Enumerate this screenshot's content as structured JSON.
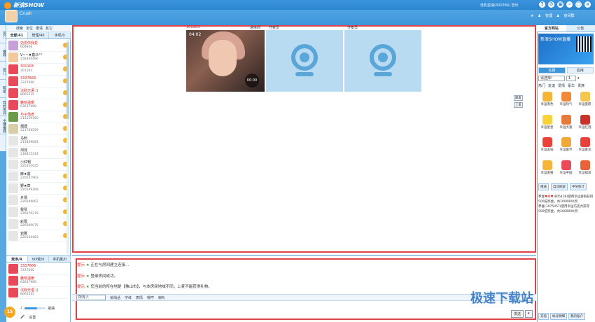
{
  "app": {
    "title": "新浪SHOW",
    "account": "佳影盈瑞(600384) 登出"
  },
  "room": {
    "username": "Crush"
  },
  "right_links": [
    "管理",
    "房间群"
  ],
  "vertical_tabs": [
    "热门",
    "推荐",
    "热门",
    "明星",
    "我的房间",
    "主播推荐"
  ],
  "left_toolbar": [
    "搜索",
    "定位",
    "邀请",
    "其它"
  ],
  "left_tabs": [
    "全部/41",
    "管理/40",
    "手机/0"
  ],
  "users": [
    {
      "name": "迈爱依我爱",
      "id": "609926",
      "red": true,
      "color": "#c7a0d8"
    },
    {
      "name": "V~~♦鑫众°°",
      "id": "258306486",
      "red": false,
      "color": "#f3c89a"
    },
    {
      "name": "301103",
      "id": "301103",
      "red": true,
      "color": "#e84a5a"
    },
    {
      "name": "3337666",
      "id": "3337666",
      "red": true,
      "color": "#e84a5a"
    },
    {
      "name": "沉默无语 ()",
      "id": "8065535",
      "red": true,
      "color": "#e84a5a"
    },
    {
      "name": "魅晓温暖",
      "id": "63637968",
      "red": true,
      "color": "#e84a5a"
    },
    {
      "name": "与子偕老",
      "id": "215559160",
      "red": true,
      "color": "#6b9a48"
    },
    {
      "name": "烟酒",
      "id": "211706559",
      "red": false,
      "color": "#d8cfa8"
    },
    {
      "name": "马刺",
      "id": "215839083",
      "red": false,
      "color": "#e6e6e6"
    },
    {
      "name": "淘淀",
      "id": "218825314",
      "red": false,
      "color": "#e6e6e6"
    },
    {
      "name": "小红帽",
      "id": "220354025",
      "red": false,
      "color": "#e6e6e6"
    },
    {
      "name": "麻★莲",
      "id": "220547963",
      "red": false,
      "color": "#e6e6e6"
    },
    {
      "name": "野★草",
      "id": "220549268",
      "red": false,
      "color": "#e6e6e6"
    },
    {
      "name": "乡情",
      "id": "226049662",
      "red": false,
      "color": "#e6e6e6"
    },
    {
      "name": "我琴",
      "id": "226070279",
      "red": false,
      "color": "#e6e6e6"
    },
    {
      "name": "彩霞",
      "id": "226090075",
      "red": false,
      "color": "#e6e6e6"
    },
    {
      "name": "岩翼",
      "id": "226104483",
      "red": false,
      "color": "#e6e6e6"
    }
  ],
  "left_tabs2": [
    "麦序/4",
    "VIP麦/0",
    "手机麦/0"
  ],
  "users2": [
    {
      "name": "3337666",
      "id": "3337666"
    },
    {
      "name": "魅晓温暖",
      "id": "63637968"
    },
    {
      "name": "沉默无语 ()",
      "id": "8065535"
    }
  ],
  "volume": {
    "label": "歌曲",
    "level": 0.6
  },
  "left_bottom": [
    "设置"
  ],
  "badge": "15",
  "video": {
    "slots": [
      {
        "label": "301103",
        "mode": "进房间"
      },
      {
        "label": "守麦员"
      },
      {
        "label": "守麦员"
      }
    ],
    "time": "04:02",
    "timer": "00:00",
    "side_buttons": [
      "踢麦",
      "上麦"
    ]
  },
  "chat": {
    "lines": [
      {
        "tag": "提示",
        "text": "正在与房间建立连接..."
      },
      {
        "tag": "提示",
        "text": "登录房间成功。"
      },
      {
        "tag": "提示",
        "text": "您当前的所在地是【佛山市】，与本房间地域不同，上麦不能获得礼物。"
      }
    ],
    "target": "所有人",
    "toolbar": [
      "悄悄话",
      "字体",
      "表情",
      "嗯哼",
      "喇叭"
    ],
    "send": "发送",
    "send_opt": "▾"
  },
  "right_tabs": [
    "官方网站",
    "公告"
  ],
  "ad_text": "新浪SHOW直播",
  "gift_tabs": [
    "礼物",
    "应用"
  ],
  "gift_select": {
    "label": "请选择!",
    "qty": "1"
  },
  "gift_cats": [
    "热门",
    "友谊",
    "爱情",
    "豪华",
    "贵族"
  ],
  "gifts": [
    {
      "name": "幸运黑色",
      "color": "#f4b63a"
    },
    {
      "name": "幸运热气",
      "color": "#f08a3a"
    },
    {
      "name": "幸运蛋糕",
      "color": "#f4c64a"
    },
    {
      "name": "幸运星星",
      "color": "#f8d23a"
    },
    {
      "name": "幸运大富",
      "color": "#e87a3a"
    },
    {
      "name": "幸运红酒",
      "color": "#c8322a"
    },
    {
      "name": "幸运美钻",
      "color": "#e8423a"
    },
    {
      "name": "幸运金币",
      "color": "#f0a83a"
    },
    {
      "name": "幸运金龙",
      "color": "#e8423a"
    },
    {
      "name": "幸运金猪",
      "color": "#f4b63a"
    },
    {
      "name": "幸运中国",
      "color": "#e84a5a"
    },
    {
      "name": "幸运福袋",
      "color": "#e8623a"
    }
  ],
  "gift_buttons": [
    "赠送",
    "自动刷屏",
    "中奖统计"
  ],
  "notices": [
    {
      "text": "恭喜",
      "red": false
    },
    {
      "text": "♥奇♥",
      "red": true
    },
    {
      "text": "(805436)使用幸运香槟获得500倍奖金，共1000000点！",
      "red": false
    },
    {
      "text": "恭喜",
      "red": false
    },
    {
      "text": "(1075457)使用幸运巧克力获得500倍奖金，共2000000点！",
      "red": false
    }
  ],
  "rp_bottom": [
    "充值",
    "帐号明细",
    "我的账户"
  ],
  "watermark": "极速下载站"
}
